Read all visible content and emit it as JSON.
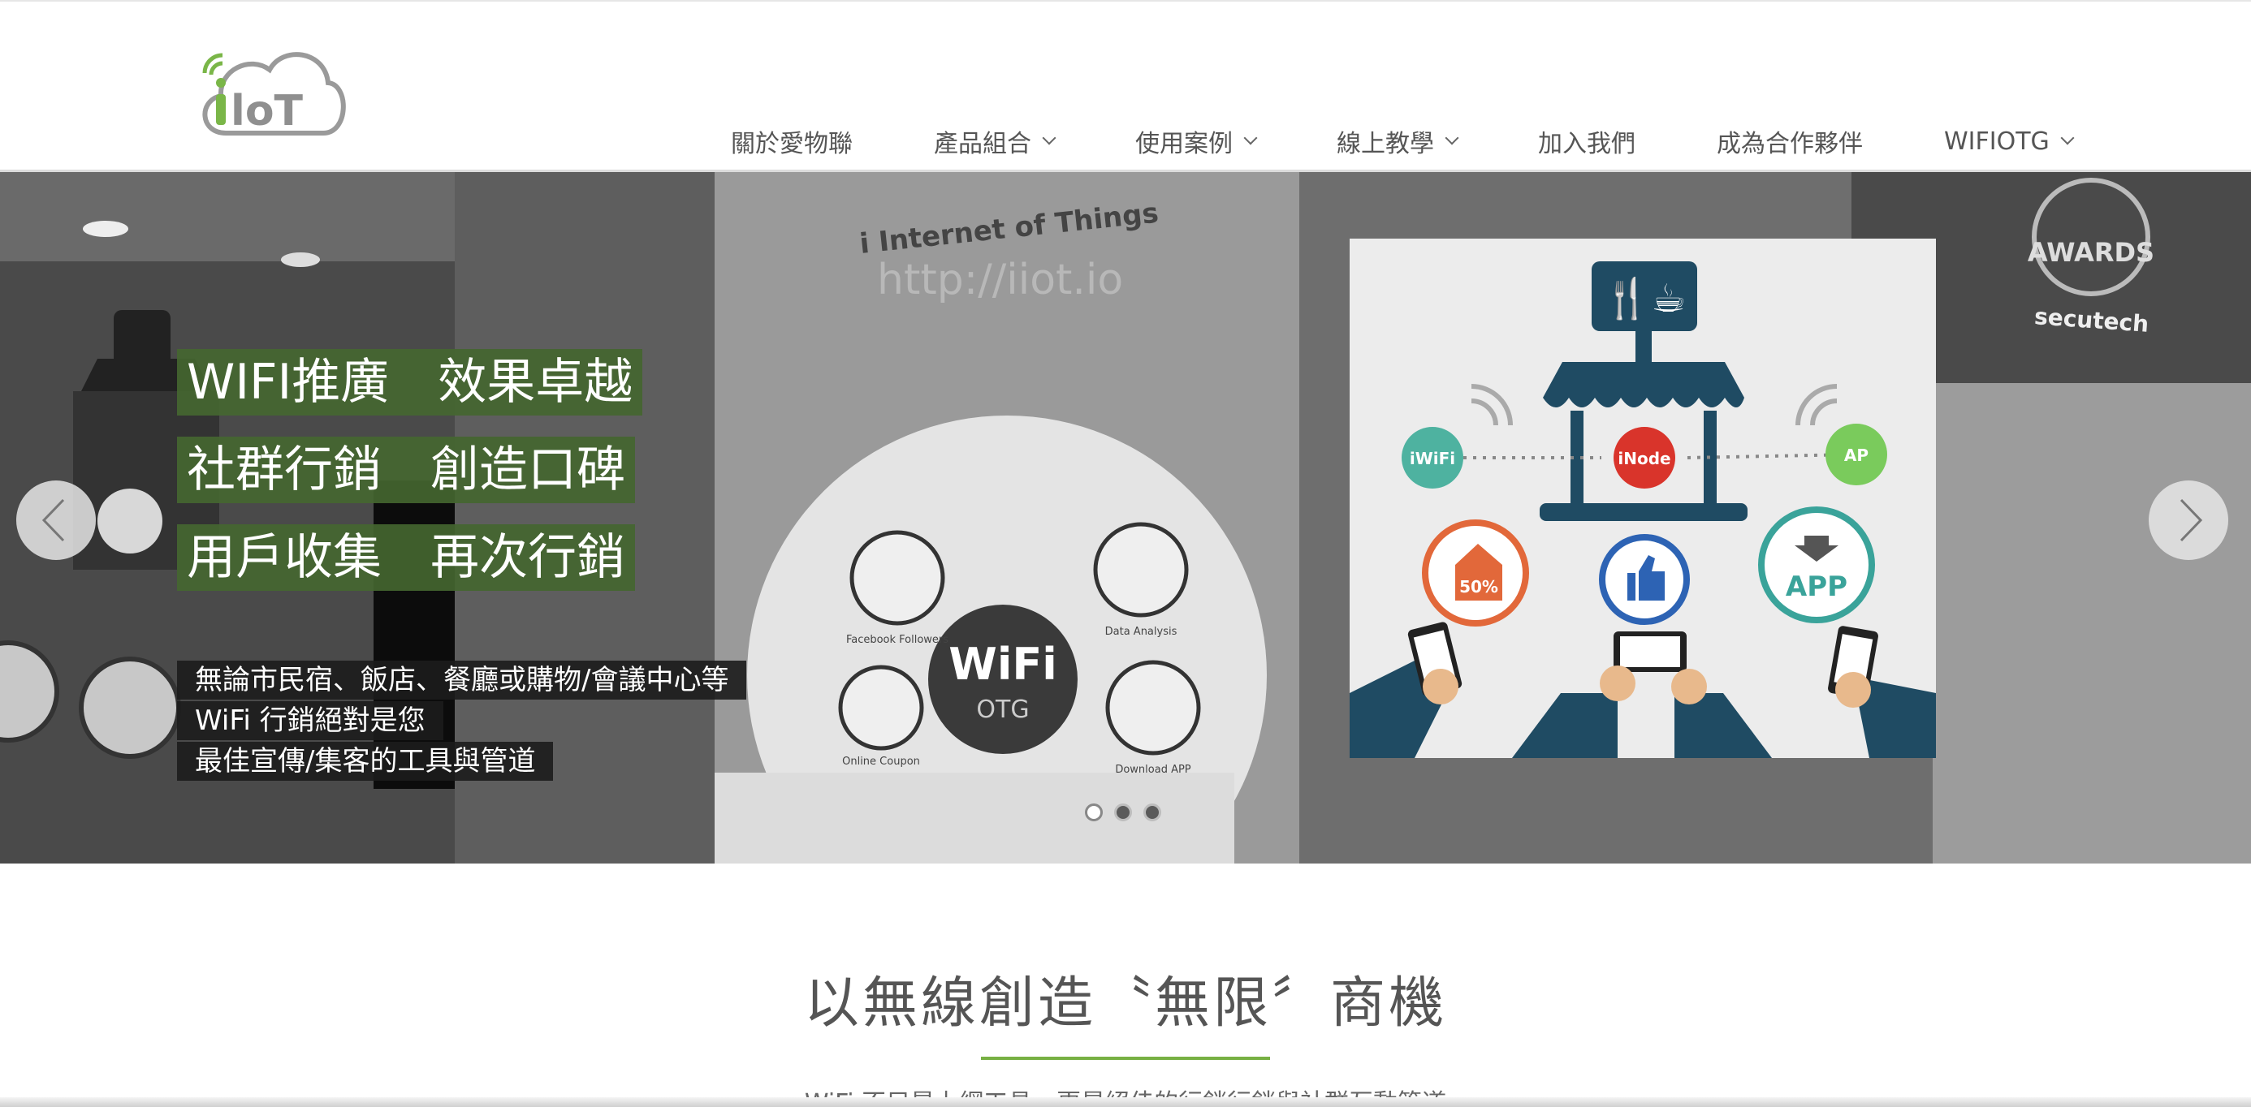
{
  "logo": {
    "text": "iIoT"
  },
  "nav": {
    "items": [
      {
        "label": "關於愛物聯",
        "has_dropdown": false
      },
      {
        "label": "產品組合",
        "has_dropdown": true
      },
      {
        "label": "使用案例",
        "has_dropdown": true
      },
      {
        "label": "線上教學",
        "has_dropdown": true
      },
      {
        "label": "加入我們",
        "has_dropdown": false
      },
      {
        "label": "成為合作夥伴",
        "has_dropdown": false
      },
      {
        "label": "WIFIOTG",
        "has_dropdown": true
      }
    ]
  },
  "hero": {
    "headlines": [
      "WIFI推廣　效果卓越",
      "社群行銷　創造口碑",
      "用戶收集　再次行銷"
    ],
    "sublines": [
      "無論市民宿、飯店、餐廳或購物/會議中心等",
      "WiFi 行銷絕對是您",
      "最佳宣傳/集客的工具與管道"
    ],
    "background_text": {
      "tagline": "i Internet of Things",
      "url": "http://iiot.io",
      "awards": "AWARDS",
      "brand": "secutech"
    },
    "kiosk": {
      "center": "WiFi",
      "center_sub": "OTG",
      "labels": [
        "Facebook Followers",
        "Data Analysis",
        "Online Coupon",
        "Download APP"
      ]
    },
    "promo": {
      "node_left": "iWiFi",
      "node_center": "iNode",
      "node_right": "AP",
      "coupon": "50%",
      "app": "APP"
    },
    "slides": {
      "count": 3,
      "active": 0
    },
    "accent_color": "#77b043"
  },
  "section": {
    "title": "以無線創造〝無限〞商機",
    "description": "WiFi 不只是上網工具，更是絕佳的行銷行銷與社群互動管道"
  }
}
